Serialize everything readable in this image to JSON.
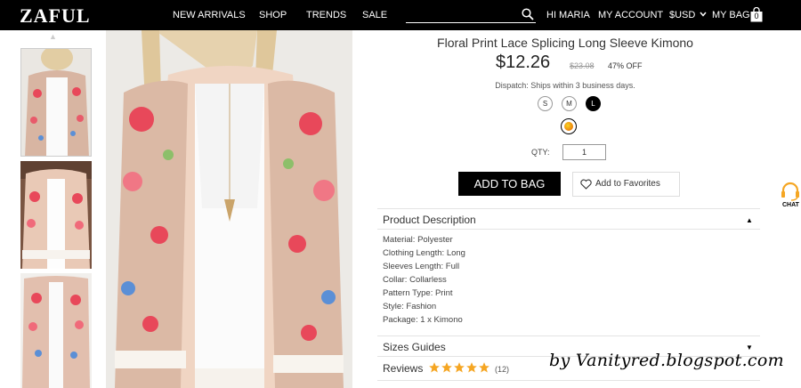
{
  "header": {
    "logo": "ZAFUL",
    "nav": [
      "NEW ARRIVALS",
      "SHOP",
      "TRENDS",
      "SALE"
    ],
    "search": {
      "value": "",
      "placeholder": ""
    },
    "greeting": "HI MARIA",
    "my_account": "MY ACCOUNT",
    "currency": "$USD",
    "my_bag": "MY BAG",
    "bag_count": "0"
  },
  "product": {
    "title": "Floral Print Lace Splicing Long Sleeve Kimono",
    "price": "$12.26",
    "old_price": "$23.08",
    "discount": "47% OFF",
    "dispatch": "Dispatch: Ships within 3 business days.",
    "sizes": [
      "S",
      "M",
      "L"
    ],
    "selected_size": "L",
    "qty_label": "QTY:",
    "qty_value": "1",
    "add_to_bag": "ADD TO BAG",
    "add_to_favorites": "Add to Favorites"
  },
  "description": {
    "title": "Product Description",
    "items": [
      "Material: Polyester",
      "Clothing Length: Long",
      "Sleeves Length: Full",
      "Collar: Collarless",
      "Pattern Type: Print",
      "Style: Fashion",
      "Package: 1 x Kimono"
    ]
  },
  "sizes_guides": "Sizes Guides",
  "reviews": {
    "label": "Reviews",
    "rating": 5,
    "count": "(12)"
  },
  "chat_label": "CHAT",
  "watermark": "by Vanityred.blogspot.com",
  "colors": {
    "header_bg": "#000000",
    "star": "#f5a623",
    "kimono": "#d9b8a4",
    "floral": "#e8485a"
  }
}
